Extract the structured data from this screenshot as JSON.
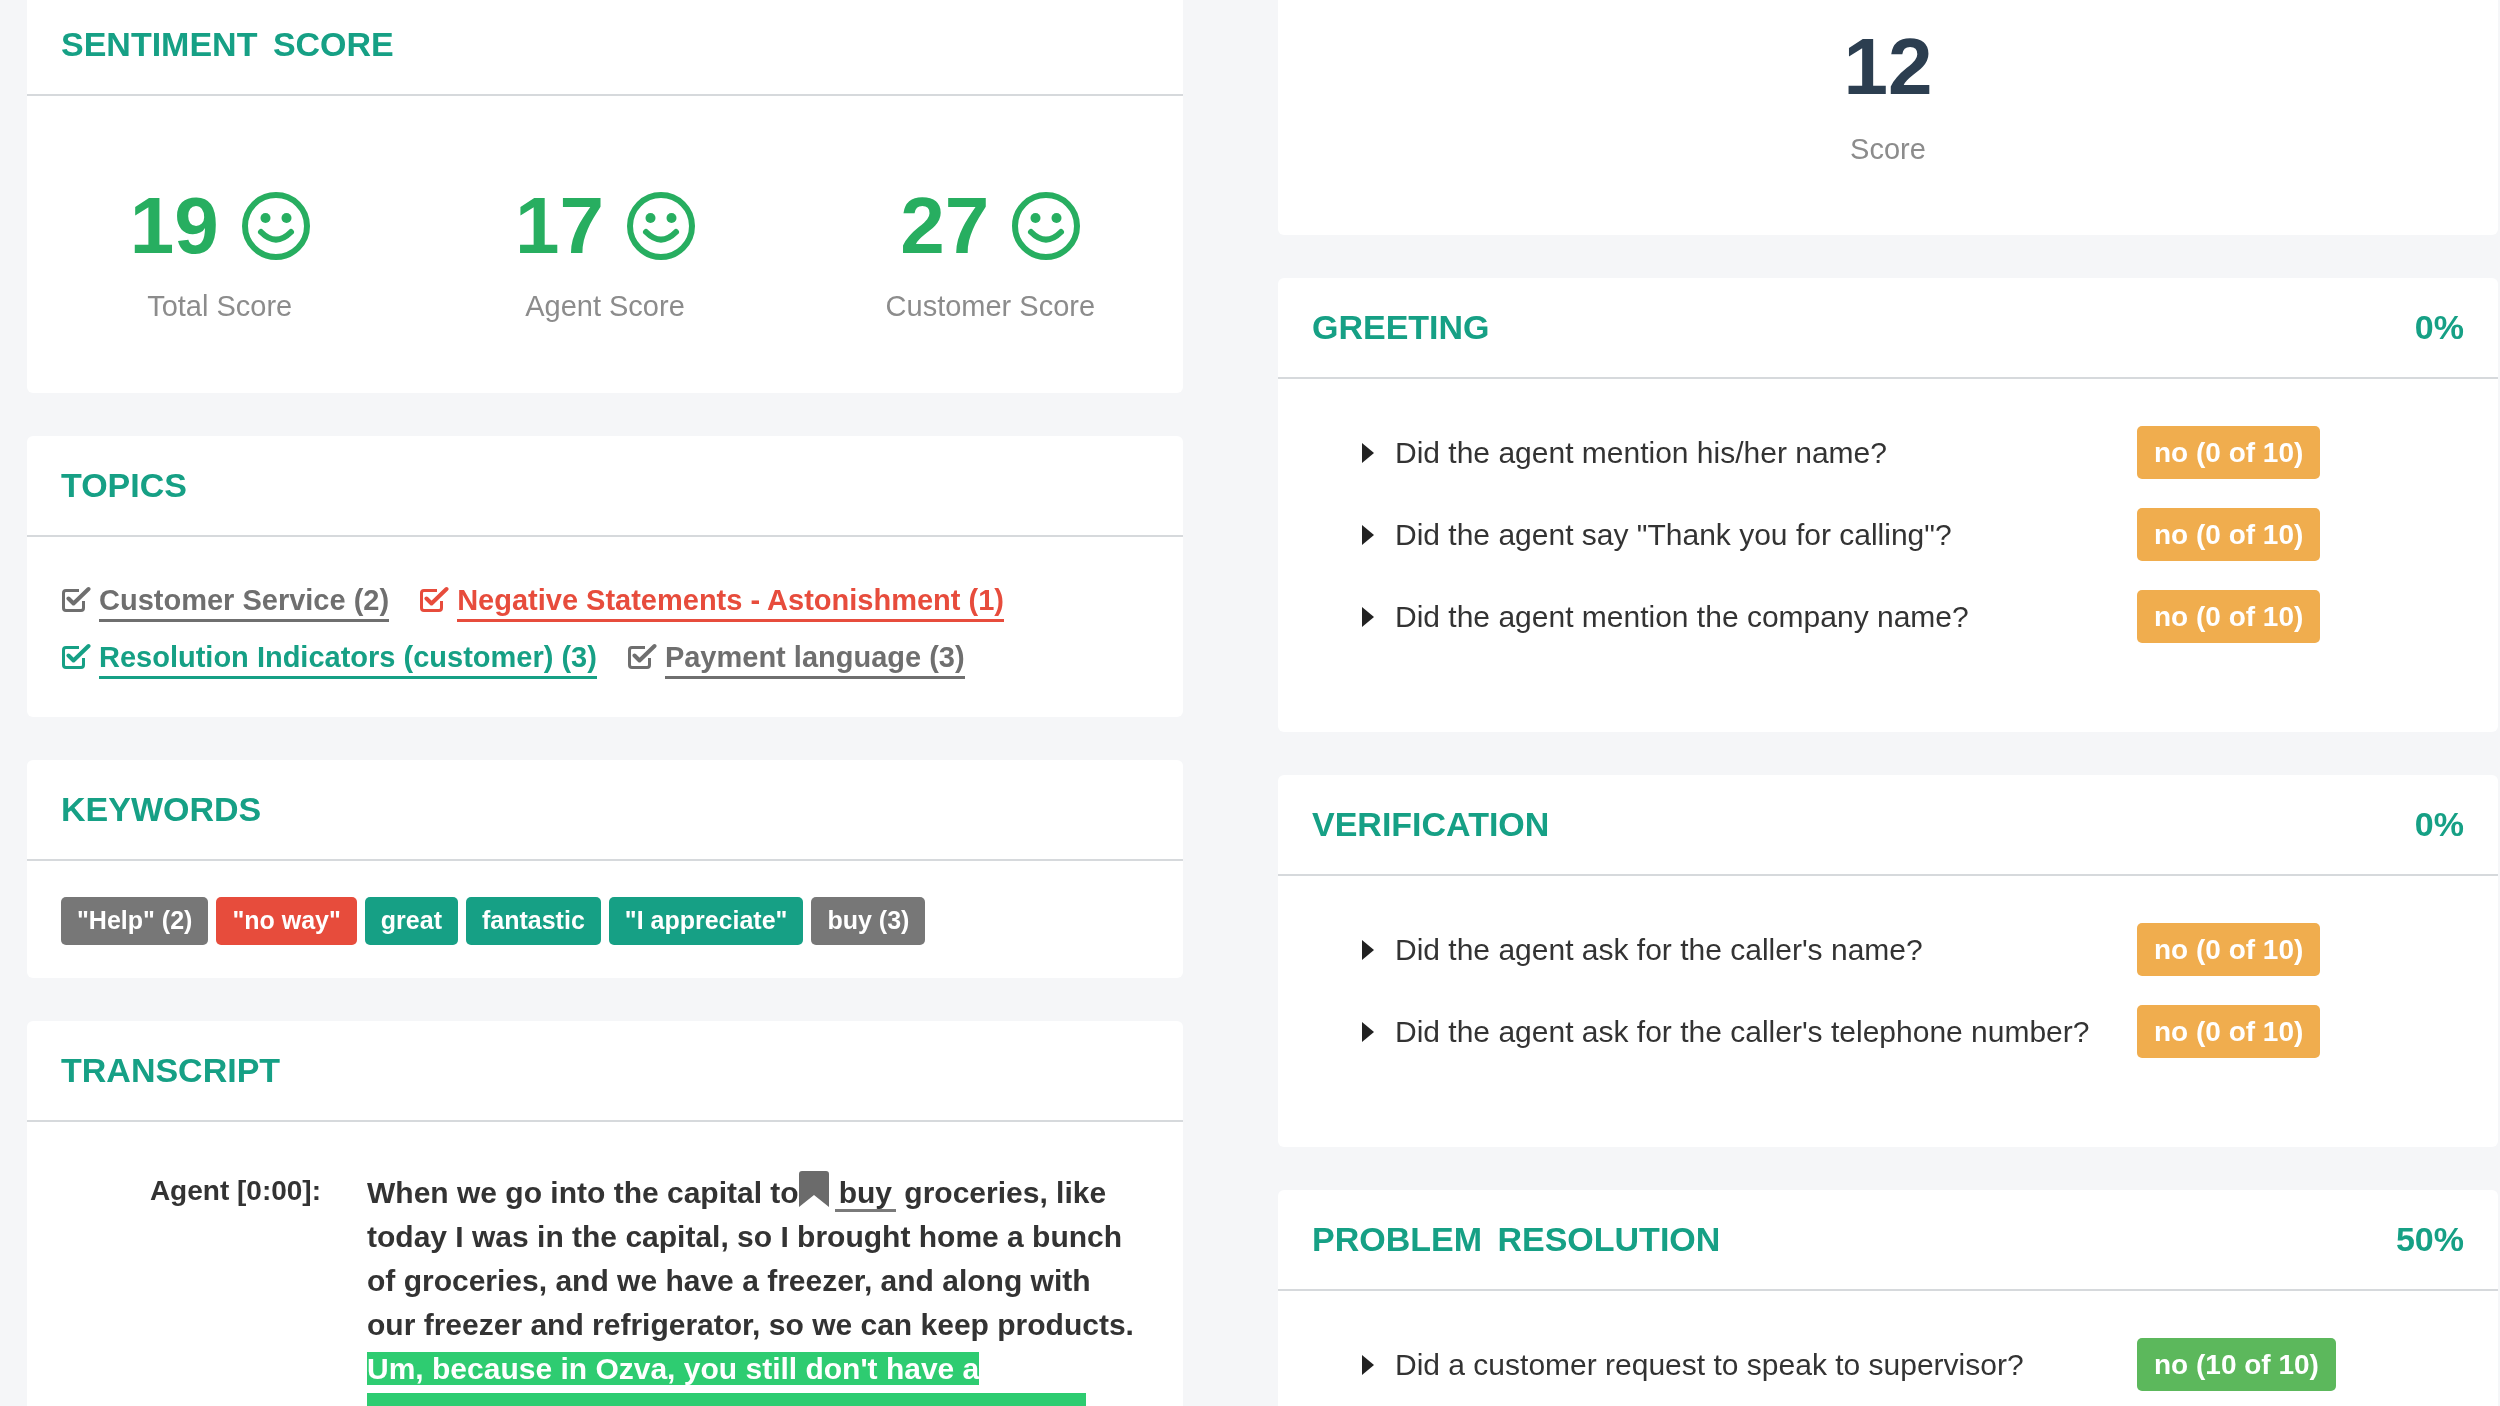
{
  "sentiment_score": {
    "title": "SENTIMENT SCORE",
    "scores": [
      {
        "value": "19",
        "label": "Total Score"
      },
      {
        "value": "17",
        "label": "Agent Score"
      },
      {
        "value": "27",
        "label": "Customer Score"
      }
    ]
  },
  "topics": {
    "title": "TOPICS",
    "items": [
      {
        "label": "Customer Service (2)",
        "checked": true,
        "color": "#6f6f6f"
      },
      {
        "label": "Negative Statements - Astonishment (1)",
        "checked": true,
        "color": "#e74c3c"
      },
      {
        "label": "Resolution Indicators (customer) (3)",
        "checked": true,
        "color": "#16a085"
      },
      {
        "label": "Payment language (3)",
        "checked": true,
        "color": "#6f6f6f"
      }
    ]
  },
  "keywords": {
    "title": "KEYWORDS",
    "items": [
      {
        "label": "\"Help\" (2)",
        "color": "#777777"
      },
      {
        "label": "\"no way\"",
        "color": "#e74c3c"
      },
      {
        "label": "great",
        "color": "#16a085"
      },
      {
        "label": "fantastic",
        "color": "#16a085"
      },
      {
        "label": "\"I appreciate\"",
        "color": "#16a085"
      },
      {
        "label": "buy (3)",
        "color": "#777777"
      }
    ]
  },
  "transcript": {
    "title": "TRANSCRIPT",
    "entries": [
      {
        "speaker": "Agent [0:00]:",
        "segments": [
          {
            "kind": "text",
            "text": "When we go into the capital to"
          },
          {
            "kind": "bookmark"
          },
          {
            "kind": "keyword",
            "text": "buy"
          },
          {
            "kind": "text",
            "text": " groceries, like today I was in the capital, so I brought home a bunch of groceries, and we have a freezer, and along with our freezer and refrigerator, so we can keep products. "
          },
          {
            "kind": "highlight",
            "text": "Um, because in Ozva, you still don't have a"
          }
        ]
      }
    ]
  },
  "score": {
    "value": "12",
    "label": "Score"
  },
  "sections": [
    {
      "title": "GREETING",
      "percent": "0%",
      "questions": [
        {
          "text": "Did the agent mention his/her name?",
          "expanded": false,
          "answer": "no (0 of 10)",
          "color": "#f0ad4e"
        },
        {
          "text": "Did the agent say \"Thank you for calling\"?",
          "expanded": false,
          "answer": "no (0 of 10)",
          "color": "#f0ad4e"
        },
        {
          "text": "Did the agent mention the company name?",
          "expanded": false,
          "answer": "no (0 of 10)",
          "color": "#f0ad4e"
        }
      ]
    },
    {
      "title": "VERIFICATION",
      "percent": "0%",
      "questions": [
        {
          "text": "Did the agent ask for the caller's name?",
          "expanded": false,
          "answer": "no (0 of 10)",
          "color": "#f0ad4e"
        },
        {
          "text": "Did the agent ask for the caller's telephone number?",
          "expanded": false,
          "answer": "no (0 of 10)",
          "color": "#f0ad4e"
        }
      ]
    },
    {
      "title": "PROBLEM RESOLUTION",
      "percent": "50%",
      "questions": [
        {
          "text": "Did a customer request to speak to supervisor?",
          "expanded": false,
          "answer": "no (10 of 10)",
          "color": "#5cb85c"
        }
      ]
    }
  ]
}
